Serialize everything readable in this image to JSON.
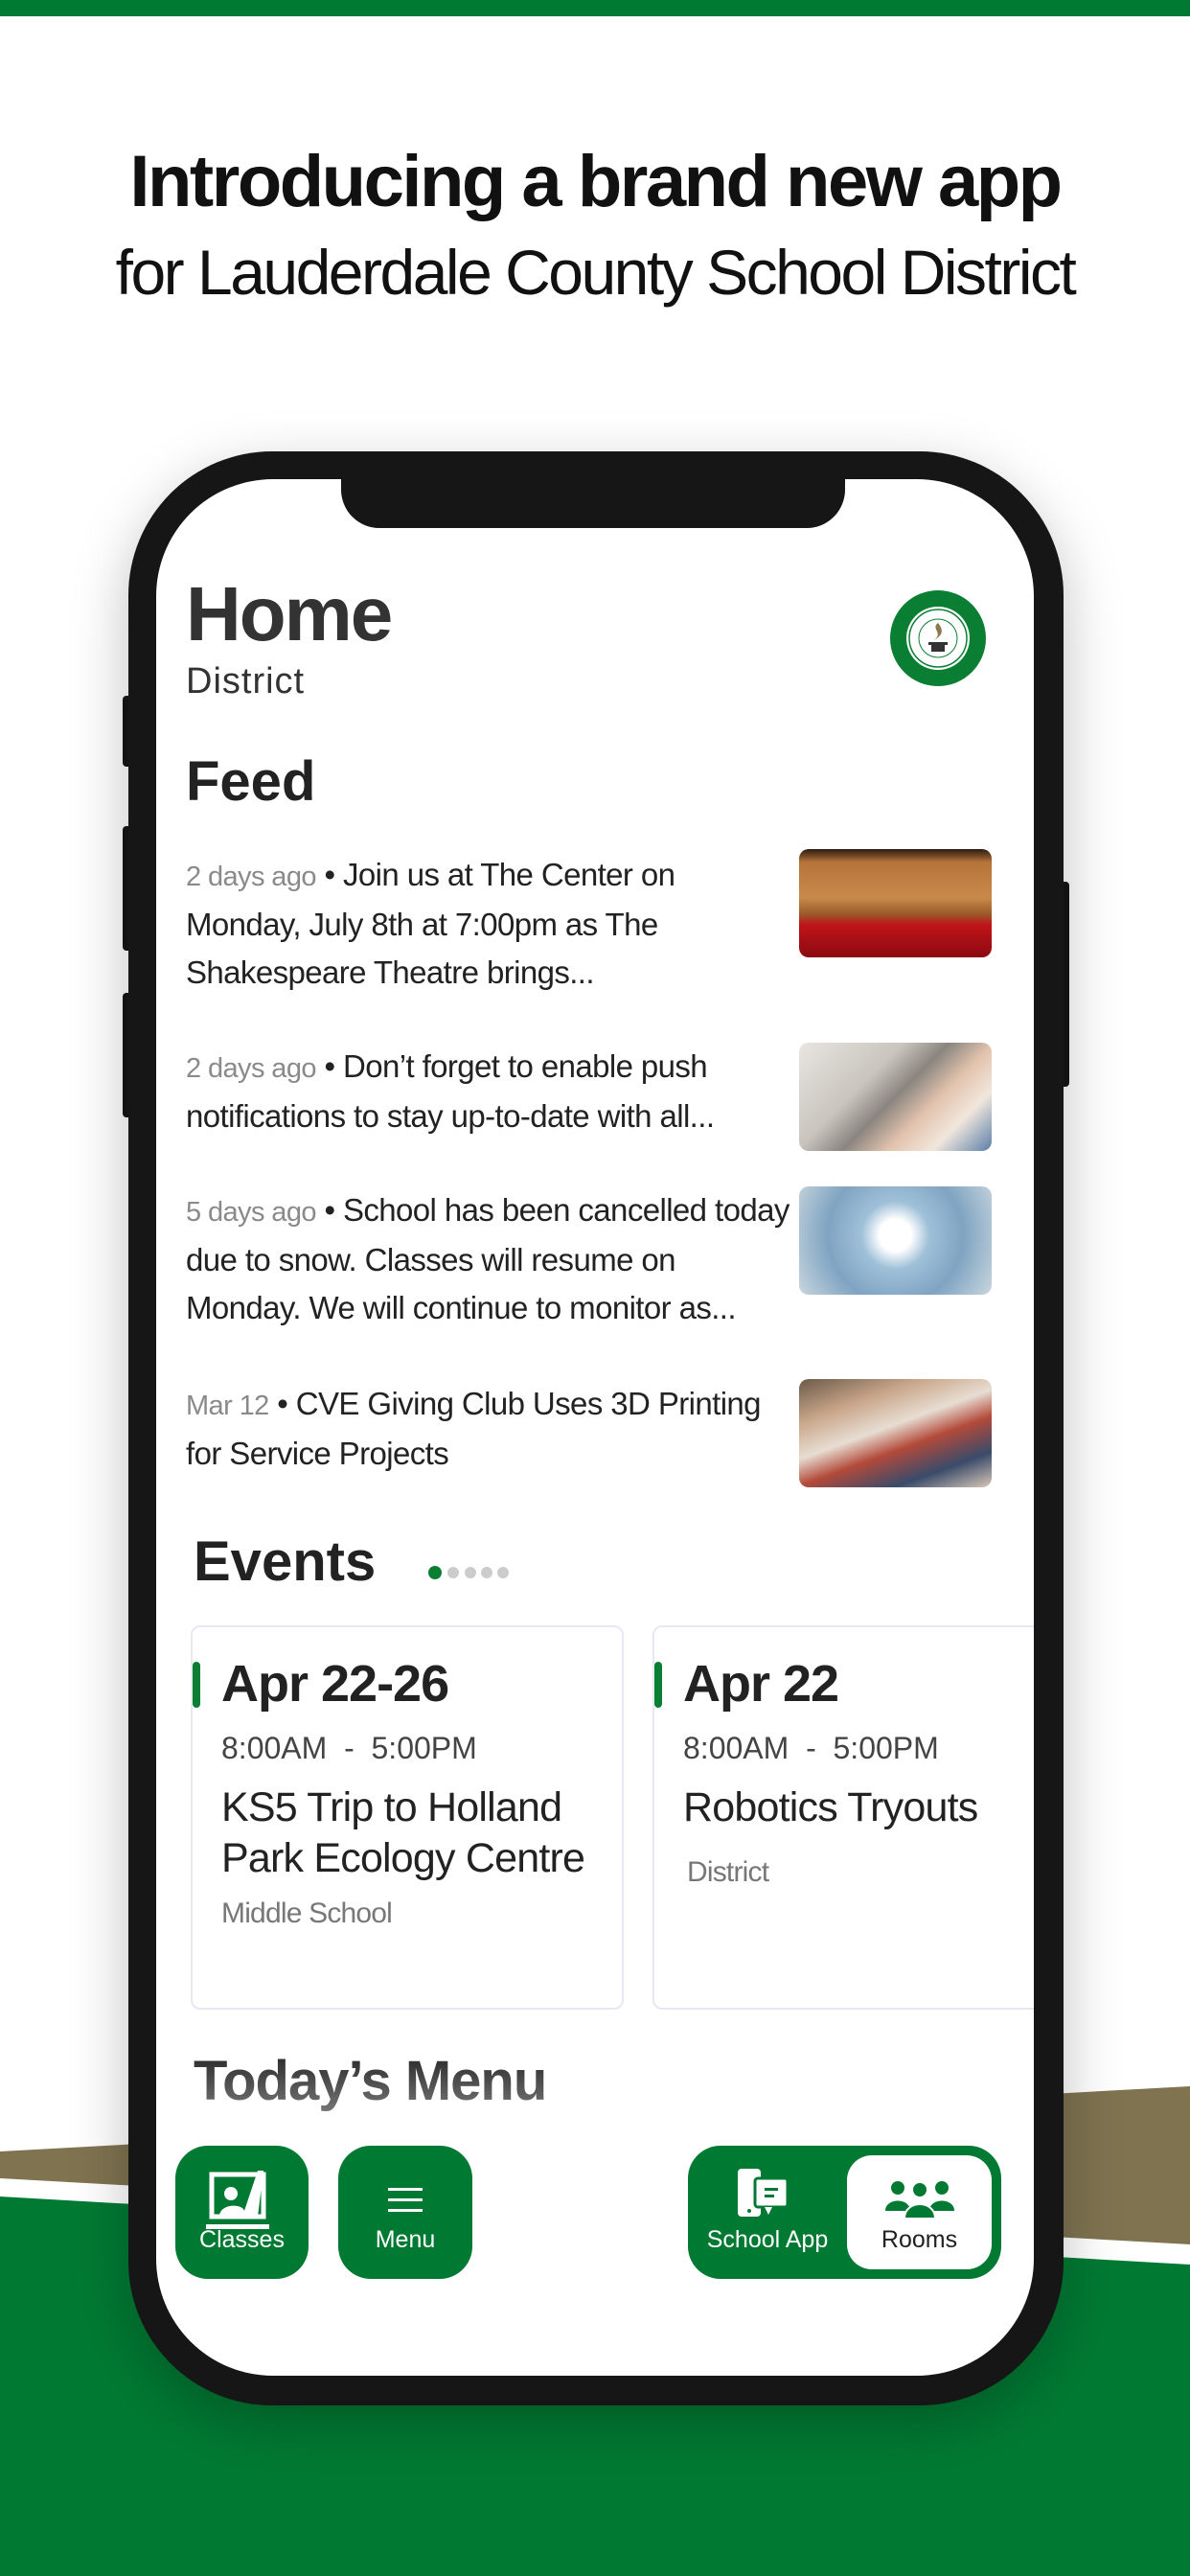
{
  "headline": {
    "line1": "Introducing a brand new app",
    "line2": "for Lauderdale County School District"
  },
  "colors": {
    "brand_green": "#007a33",
    "olive": "#7f7350",
    "text": "#222222"
  },
  "app": {
    "title": "Home",
    "subtitle": "District",
    "logo_text": "LAUDERDALE COUNTY SCHOOLS",
    "feed": {
      "title": "Feed",
      "items": [
        {
          "time": "2 days ago",
          "text": "Join us at The Center on Monday, July 8th at 7:00pm as The Shakespeare Theatre brings...",
          "image": "theatre-seats"
        },
        {
          "time": "2 days ago",
          "text": "Don’t forget to enable push notifications to stay up-to-date with all...",
          "image": "phone-in-hand"
        },
        {
          "time": "5 days ago",
          "text": "School has been cancelled today due to snow. Classes will resume on Monday. We will continue to monitor as...",
          "image": "snowflake-mittens"
        },
        {
          "time": "Mar 12",
          "text": "CVE Giving Club Uses 3D Printing for Service Projects",
          "image": "classroom"
        }
      ]
    },
    "events": {
      "title": "Events",
      "page_count": 5,
      "active_page": 1,
      "items": [
        {
          "date": "Apr 22-26",
          "time": "8:00AM  -  5:00PM",
          "title": "KS5 Trip to Holland Park Ecology Centre",
          "location": "Middle School"
        },
        {
          "date": "Apr 22",
          "time": "8:00AM  -  5:00PM",
          "title": "Robotics Tryouts",
          "location": "District"
        }
      ]
    },
    "menu": {
      "title": "Today’s Menu"
    },
    "bottom_nav": {
      "classes": {
        "label": "Classes",
        "icon": "classroom-icon"
      },
      "menu": {
        "label": "Menu",
        "icon": "hamburger-icon"
      },
      "school_app": {
        "label": "School App",
        "icon": "phone-chat-icon"
      },
      "rooms": {
        "label": "Rooms",
        "icon": "people-icon",
        "selected": true
      }
    }
  }
}
